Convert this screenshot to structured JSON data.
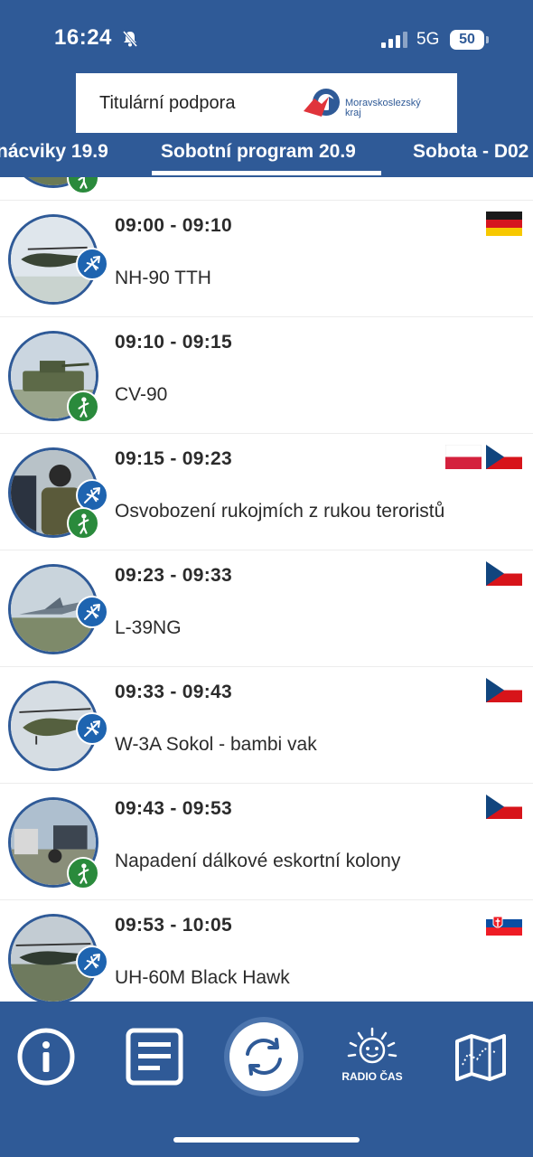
{
  "status_bar": {
    "time": "16:24",
    "network": "5G",
    "battery": "50"
  },
  "banner": {
    "text": "Titulární podpora",
    "logo_text_line1": "Moravskoslezský",
    "logo_text_line2": "kraj"
  },
  "tabs": [
    {
      "label": "nácviky 19.9"
    },
    {
      "label": "Sobotní program 20.9"
    },
    {
      "label": "Sobota - D02"
    }
  ],
  "active_tab": "Sobotní program 20.9",
  "program": [
    {
      "time": "09:00 - 09:10",
      "name": "NH-90 TTH",
      "badges": [
        "air"
      ],
      "flags": [
        "germany"
      ]
    },
    {
      "time": "09:10 - 09:15",
      "name": "CV-90",
      "badges": [
        "ground"
      ],
      "flags": []
    },
    {
      "time": "09:15 - 09:23",
      "name": "Osvobození rukojmích z rukou teroristů",
      "badges": [
        "air",
        "ground"
      ],
      "flags": [
        "poland",
        "czech"
      ]
    },
    {
      "time": "09:23 - 09:33",
      "name": "L-39NG",
      "badges": [
        "air"
      ],
      "flags": [
        "czech"
      ]
    },
    {
      "time": "09:33 - 09:43",
      "name": "W-3A Sokol - bambi vak",
      "badges": [
        "air"
      ],
      "flags": [
        "czech"
      ]
    },
    {
      "time": "09:43 - 09:53",
      "name": "Napadení dálkové eskortní kolony",
      "badges": [
        "ground"
      ],
      "flags": [
        "czech"
      ]
    },
    {
      "time": "09:53 - 10:05",
      "name": "UH-60M Black Hawk",
      "badges": [
        "air"
      ],
      "flags": [
        "slovakia"
      ]
    }
  ],
  "bottom_nav": {
    "info_icon": "info-icon",
    "program_icon": "document-icon",
    "refresh_icon": "refresh-icon",
    "radio_label": "RADIO ČAS",
    "map_icon": "map-icon"
  },
  "colors": {
    "primary": "#2f5a97",
    "air_badge": "#1e64b0",
    "ground_badge": "#2a8a3c"
  }
}
